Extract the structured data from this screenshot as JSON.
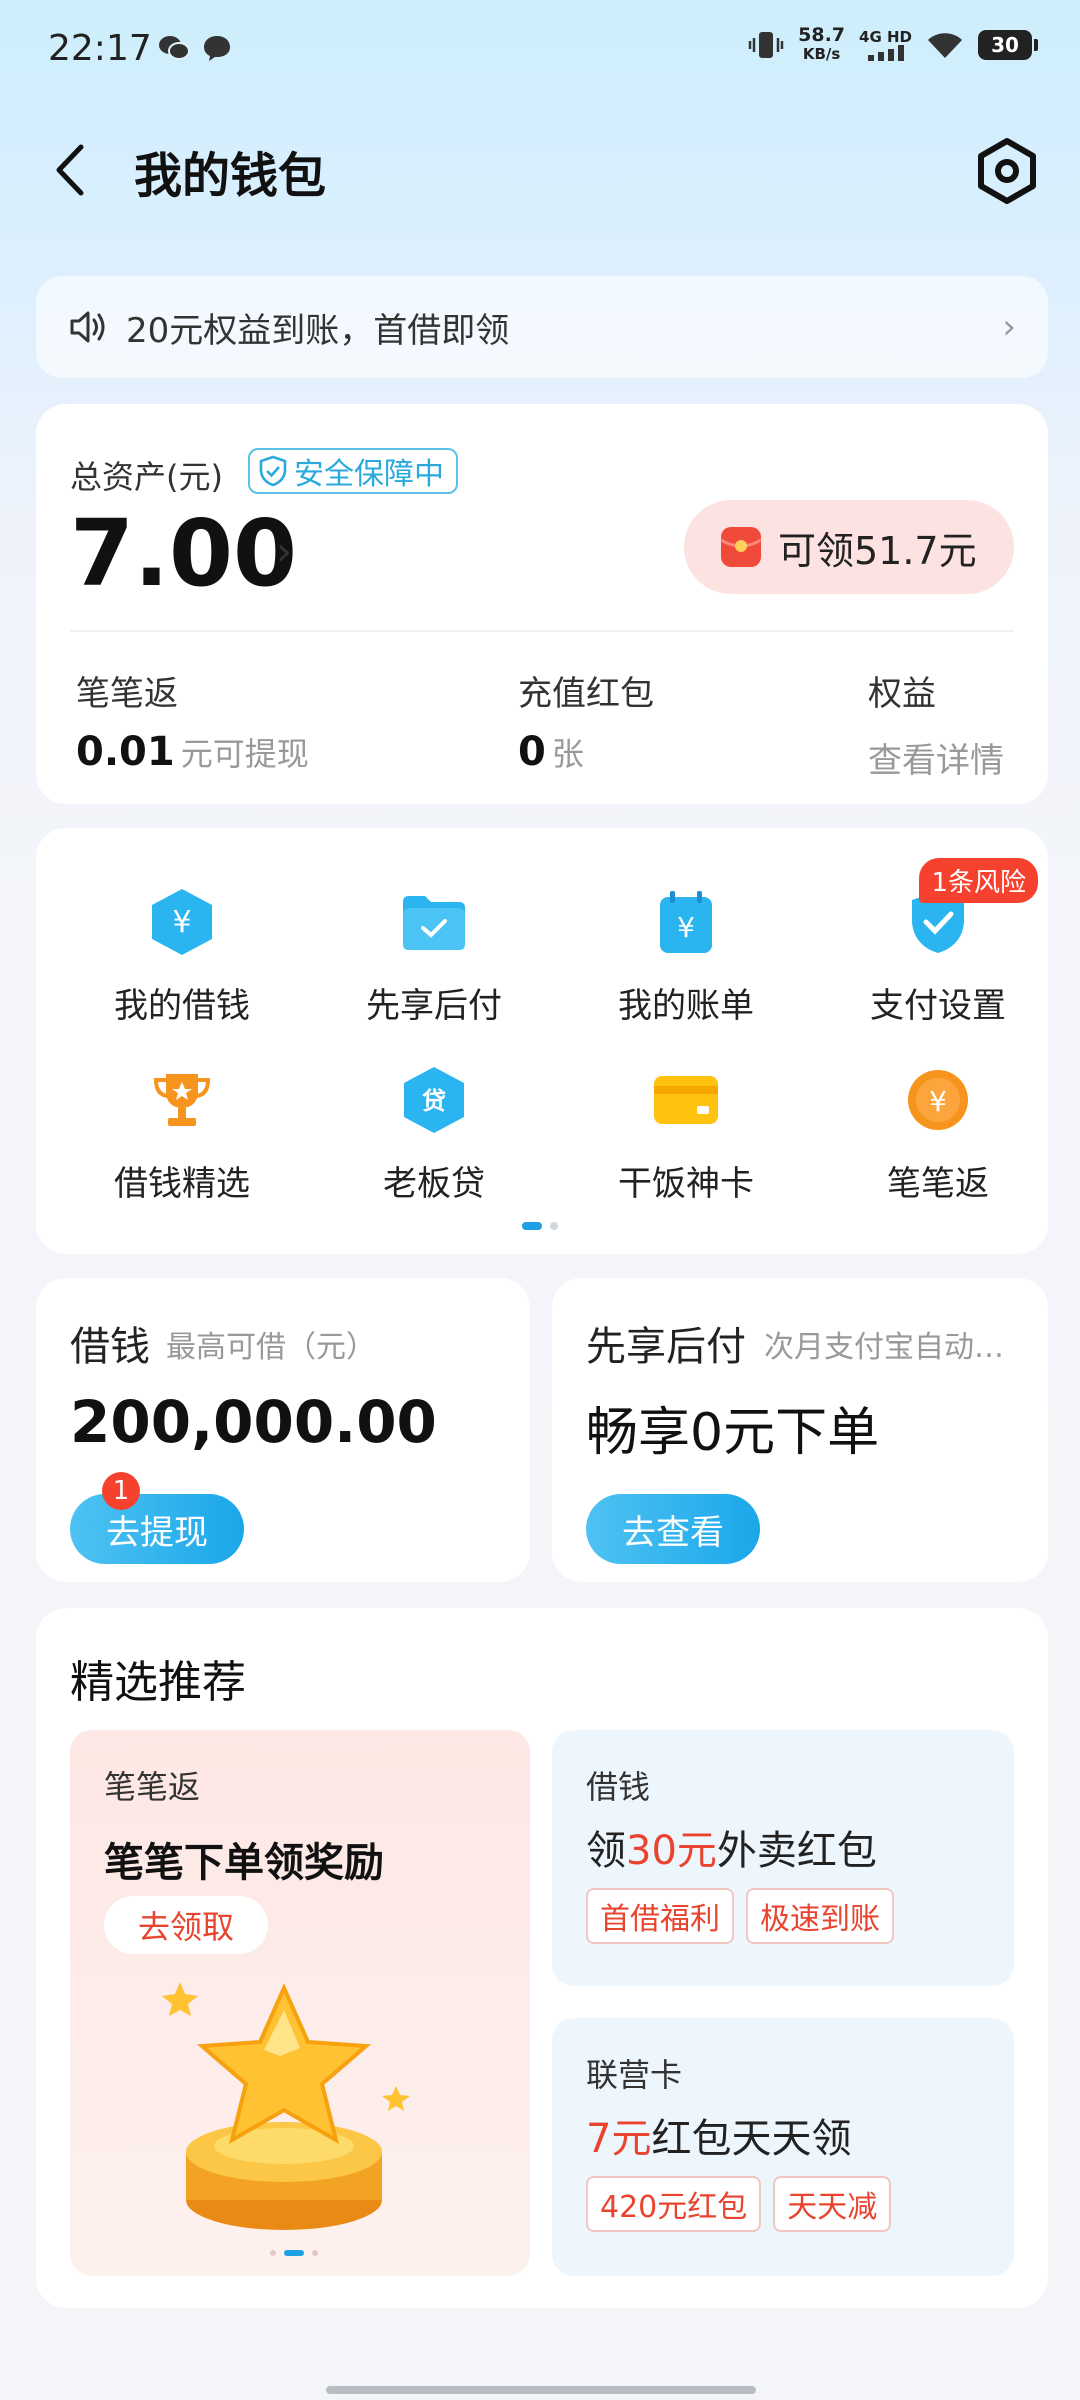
{
  "status_bar": {
    "time": "22:17",
    "speed_value": "58.7",
    "speed_unit": "KB/s",
    "network": "4G HD",
    "battery": "30"
  },
  "header": {
    "title": "我的钱包"
  },
  "notice": {
    "text": "20元权益到账，首借即领"
  },
  "assets": {
    "label": "总资产(元)",
    "secure_badge": "安全保障中",
    "value": "7.00",
    "claim": "可领51.7元",
    "stats": [
      {
        "label": "笔笔返",
        "value": "0.01",
        "unit": "元可提现"
      },
      {
        "label": "充值红包",
        "value": "0",
        "unit": "张"
      },
      {
        "label": "权益",
        "link": "查看详情"
      }
    ]
  },
  "services": {
    "items": [
      {
        "label": "我的借钱",
        "icon": "loan-hexagon-icon"
      },
      {
        "label": "先享后付",
        "icon": "folder-check-icon"
      },
      {
        "label": "我的账单",
        "icon": "bill-calendar-icon"
      },
      {
        "label": "支付设置",
        "icon": "shield-check-icon",
        "badge": "1条风险"
      },
      {
        "label": "借钱精选",
        "icon": "trophy-icon"
      },
      {
        "label": "老板贷",
        "icon": "loan-dai-icon"
      },
      {
        "label": "干饭神卡",
        "icon": "card-icon"
      },
      {
        "label": "笔笔返",
        "icon": "yuan-coin-icon"
      }
    ]
  },
  "loan": {
    "title": "借钱",
    "sub": "最高可借（元）",
    "amount": "200,000.00",
    "button": "去提现",
    "badge": "1"
  },
  "bnpl": {
    "title": "先享后付",
    "sub": "次月支付宝自动…",
    "headline": "畅享0元下单",
    "button": "去查看"
  },
  "recommend": {
    "title": "精选推荐",
    "big": {
      "category": "笔笔返",
      "title": "笔笔下单领奖励",
      "button": "去领取"
    },
    "small": [
      {
        "category": "借钱",
        "title_prefix": "领",
        "title_highlight": "30元",
        "title_suffix": "外卖红包",
        "tags": [
          "首借福利",
          "极速到账"
        ]
      },
      {
        "category": "联营卡",
        "title_prefix": "",
        "title_highlight": "7元",
        "title_suffix": "红包天天领",
        "tags": [
          "420元红包",
          "天天减"
        ]
      }
    ]
  },
  "colors": {
    "accent_blue": "#1aa7ea",
    "badge_red": "#f5412d",
    "highlight_red": "#e9442f"
  }
}
